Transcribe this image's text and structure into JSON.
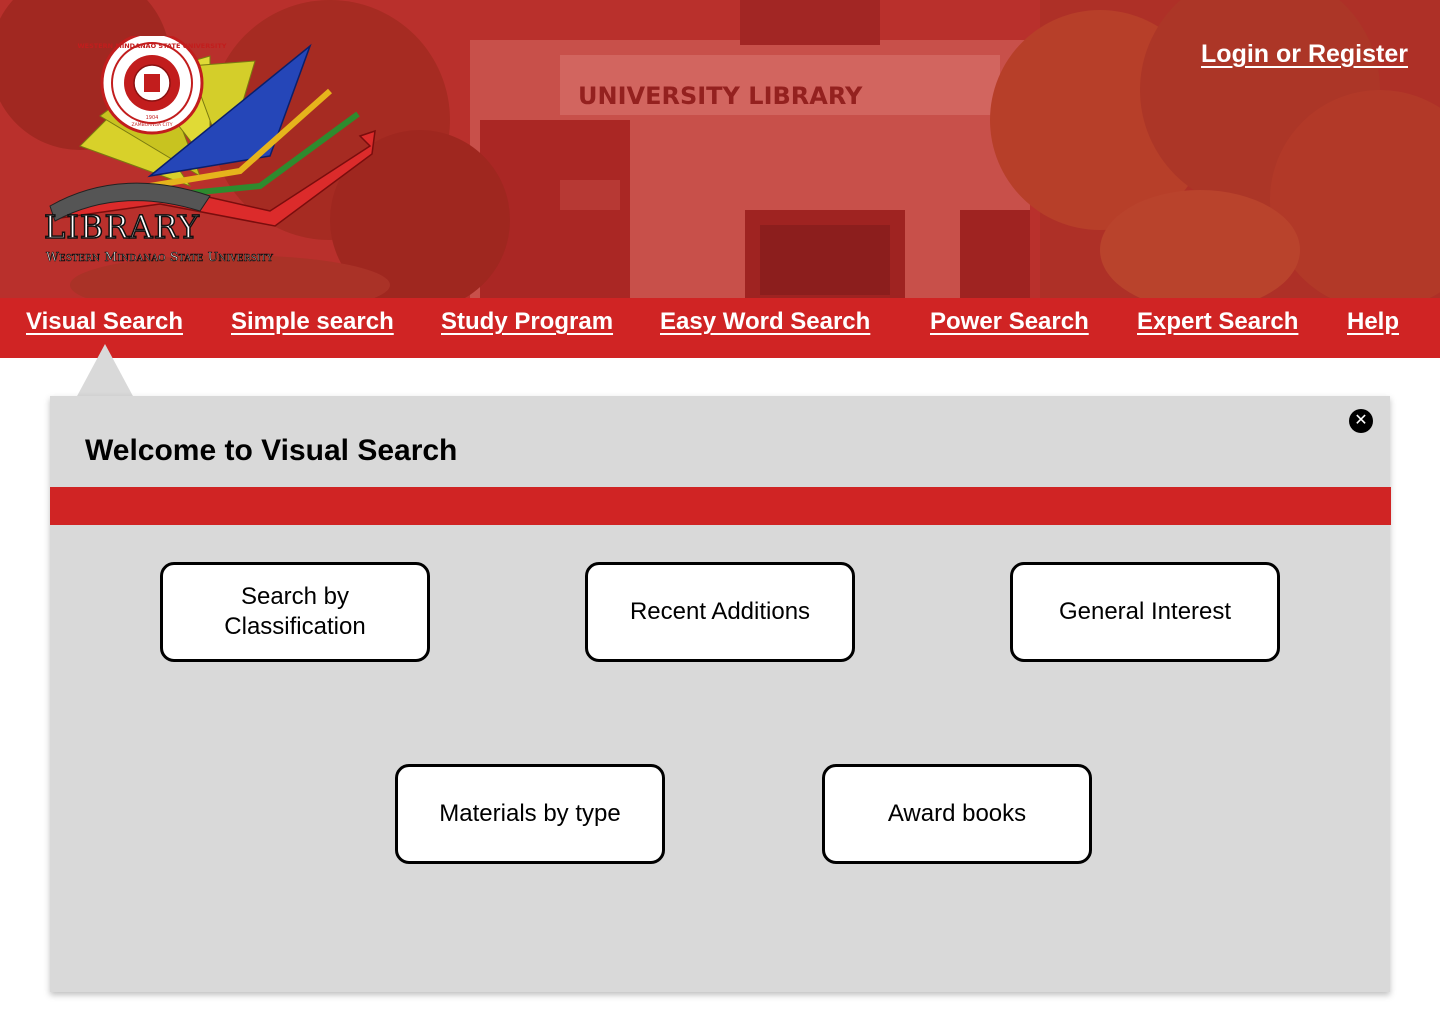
{
  "header": {
    "logo": {
      "library_text": "LIBRARY",
      "university_text": "Western Mindanao State University",
      "seal_text": "WESTERN MINDANAO STATE UNIVERSITY",
      "seal_year": "1904",
      "seal_city": "ZAMBOANGA CITY"
    },
    "building_sign": "UNIVERSITY LIBRARY",
    "login_label": "Login or Register"
  },
  "nav": {
    "items": [
      {
        "label": "Visual Search",
        "active": true
      },
      {
        "label": "Simple search"
      },
      {
        "label": "Study Program"
      },
      {
        "label": "Easy Word Search"
      },
      {
        "label": "Power Search"
      },
      {
        "label": "Expert Search"
      },
      {
        "label": "Help"
      }
    ]
  },
  "panel": {
    "title": "Welcome to Visual Search",
    "close_icon": "close-icon",
    "tiles": [
      {
        "label": "Search by Classification"
      },
      {
        "label": "Recent Additions"
      },
      {
        "label": "General Interest"
      },
      {
        "label": "Materials by type"
      },
      {
        "label": "Award books"
      }
    ]
  },
  "colors": {
    "accent_red": "#d02424",
    "panel_bg": "#d9d9d9"
  }
}
